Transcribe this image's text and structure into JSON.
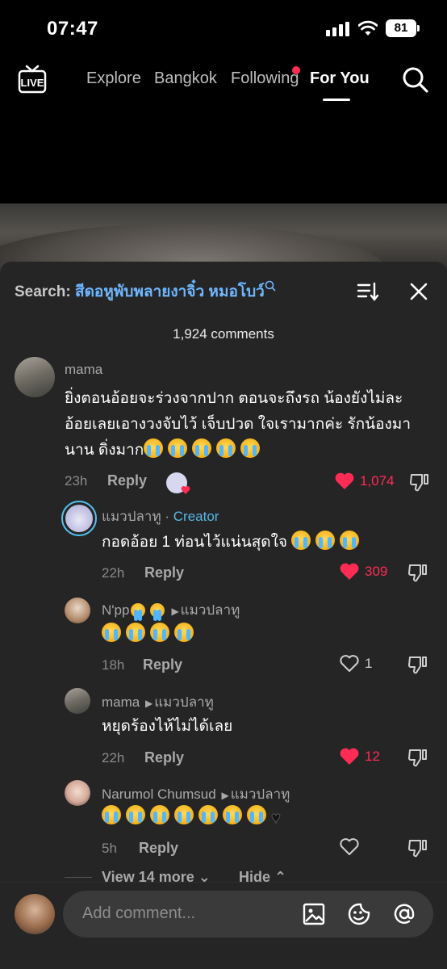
{
  "status": {
    "time": "07:47",
    "battery": "81"
  },
  "nav": {
    "tabs": [
      {
        "label": "Explore"
      },
      {
        "label": "Bangkok"
      },
      {
        "label": "Following"
      },
      {
        "label": "For You"
      }
    ],
    "live_label": "LIVE"
  },
  "panel": {
    "search_prefix": "Search:",
    "search_query": "สีดอหูพับพลายงาจิ๋ว หมอโบว์",
    "comments_count": "1,924 comments"
  },
  "comments": [
    {
      "username": "mama",
      "lines": [
        "ยิ่งตอนอ้อยจะร่วงจากปาก ตอนจะถึงรถ น้องยังไม่ละ",
        "อ้อยเลยเอางวงจับไว้ เจ็บปวด ใจเรามากค่ะ รักน้องมา",
        "นาน ดิ่งมาก"
      ],
      "time": "23h",
      "reply": "Reply",
      "likes": "1,074",
      "liked": true
    },
    {
      "username": "แมวปลาทู",
      "creator_tag": "Creator",
      "lines": [
        "กอดอ้อย 1 ท่อนไว้แน่นสุดใจ"
      ],
      "time": "22h",
      "reply": "Reply",
      "likes": "309",
      "liked": true
    },
    {
      "username": "N'pp",
      "reply_to": "แมวปลาทู",
      "lines": [
        ""
      ],
      "time": "18h",
      "reply": "Reply",
      "likes": "1",
      "liked": false
    },
    {
      "username": "mama",
      "reply_to": "แมวปลาทู",
      "lines": [
        "หยุดร้องไห้ไม่ได้เลย"
      ],
      "time": "22h",
      "reply": "Reply",
      "likes": "12",
      "liked": true
    },
    {
      "username": "Narumol  Chumsud",
      "reply_to": "แมวปลาทู",
      "lines": [
        ""
      ],
      "time": "5h",
      "reply": "Reply",
      "likes": "",
      "liked": false
    }
  ],
  "thread_controls": {
    "view_more": "View 14 more",
    "hide": "Hide"
  },
  "input": {
    "placeholder": "Add comment..."
  },
  "colors": {
    "like_red": "#fe2c55",
    "link_blue": "#6eb7ff",
    "creator_blue": "#5bb6e6",
    "panel_bg": "#252525"
  }
}
